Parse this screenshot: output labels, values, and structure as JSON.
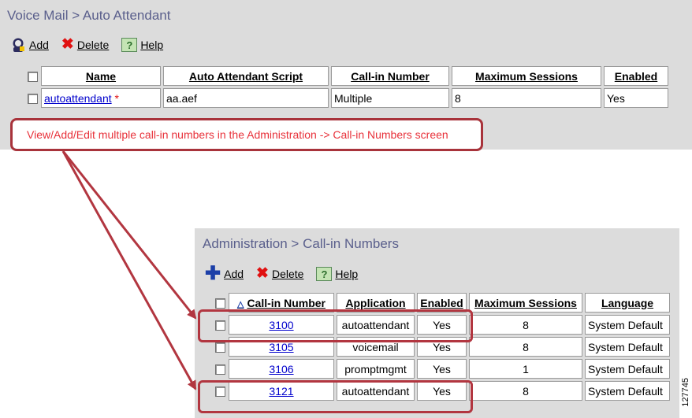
{
  "top_panel": {
    "breadcrumb": "Voice Mail > Auto Attendant",
    "toolbar": {
      "add": "Add",
      "delete": "Delete",
      "help": "Help"
    },
    "table": {
      "headers": [
        "Name",
        "Auto Attendant Script",
        "Call-in Number",
        "Maximum Sessions",
        "Enabled"
      ],
      "row": {
        "name": "autoattendant",
        "required_marker": "*",
        "script": "aa.aef",
        "call_in": "Multiple",
        "max_sessions": "8",
        "enabled": "Yes"
      }
    }
  },
  "callout": {
    "text": "View/Add/Edit multiple call-in numbers in the Administration -> Call-in Numbers screen"
  },
  "bottom_panel": {
    "breadcrumb": "Administration > Call-in Numbers",
    "toolbar": {
      "add": "Add",
      "delete": "Delete",
      "help": "Help"
    },
    "table": {
      "headers": [
        "Call-in Number",
        "Application",
        "Enabled",
        "Maximum Sessions",
        "Language"
      ],
      "rows": [
        {
          "number": "3100",
          "application": "autoattendant",
          "enabled": "Yes",
          "max_sessions": "8",
          "language": "System Default"
        },
        {
          "number": "3105",
          "application": "voicemail",
          "enabled": "Yes",
          "max_sessions": "8",
          "language": "System Default"
        },
        {
          "number": "3106",
          "application": "promptmgmt",
          "enabled": "Yes",
          "max_sessions": "1",
          "language": "System Default"
        },
        {
          "number": "3121",
          "application": "autoattendant",
          "enabled": "Yes",
          "max_sessions": "8",
          "language": "System Default"
        }
      ]
    }
  },
  "figure_id": "127745",
  "colors": {
    "title": "#5a5f8c",
    "link": "#0000cc",
    "callout_border": "#a8333b",
    "callout_text": "#e8313a",
    "panel_bg": "#dcdcdc"
  }
}
